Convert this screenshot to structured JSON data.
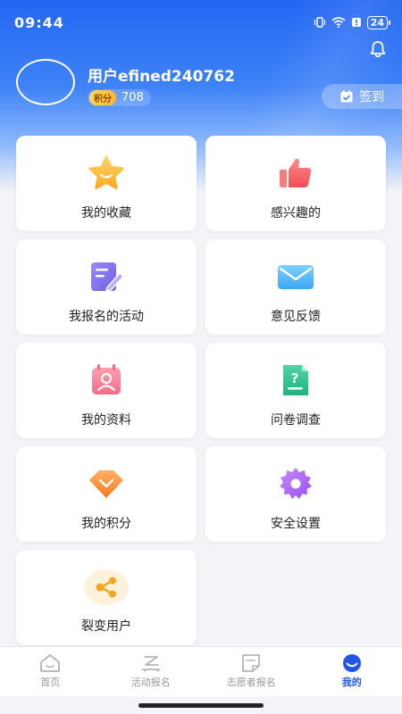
{
  "status": {
    "time": "09:44",
    "battery": "24"
  },
  "profile": {
    "username": "用户efined240762",
    "points_badge": "积分",
    "points_value": "708",
    "checkin_label": "签到"
  },
  "menu": [
    {
      "label": "我的收藏",
      "icon": "star-icon"
    },
    {
      "label": "感兴趣的",
      "icon": "thumbs-up-icon"
    },
    {
      "label": "我报名的活动",
      "icon": "edit-document-icon"
    },
    {
      "label": "意见反馈",
      "icon": "envelope-icon"
    },
    {
      "label": "我的资料",
      "icon": "profile-card-icon"
    },
    {
      "label": "问卷调查",
      "icon": "question-document-icon"
    },
    {
      "label": "我的积分",
      "icon": "diamond-icon"
    },
    {
      "label": "安全设置",
      "icon": "gear-icon"
    },
    {
      "label": "裂变用户",
      "icon": "share-icon"
    }
  ],
  "tabbar": [
    {
      "label": "首页",
      "icon": "home-icon"
    },
    {
      "label": "活动报名",
      "icon": "activity-icon"
    },
    {
      "label": "志愿者报名",
      "icon": "volunteer-form-icon"
    },
    {
      "label": "我的",
      "icon": "user-face-icon",
      "active": true
    }
  ],
  "colors": {
    "primary": "#1d56e8",
    "header_top": "#2466f2"
  }
}
